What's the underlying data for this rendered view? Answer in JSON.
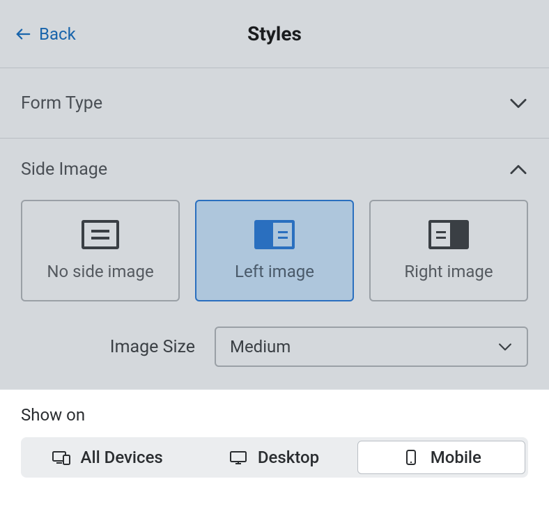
{
  "header": {
    "back_label": "Back",
    "title": "Styles"
  },
  "sections": {
    "form_type": {
      "label": "Form Type",
      "expanded": false
    },
    "side_image": {
      "label": "Side Image",
      "expanded": true,
      "options": [
        {
          "label": "No side image",
          "selected": false
        },
        {
          "label": "Left image",
          "selected": true
        },
        {
          "label": "Right image",
          "selected": false
        }
      ],
      "image_size": {
        "label": "Image Size",
        "value": "Medium"
      }
    }
  },
  "show_on": {
    "label": "Show on",
    "options": [
      {
        "label": "All Devices",
        "selected": false
      },
      {
        "label": "Desktop",
        "selected": false
      },
      {
        "label": "Mobile",
        "selected": true
      }
    ]
  }
}
